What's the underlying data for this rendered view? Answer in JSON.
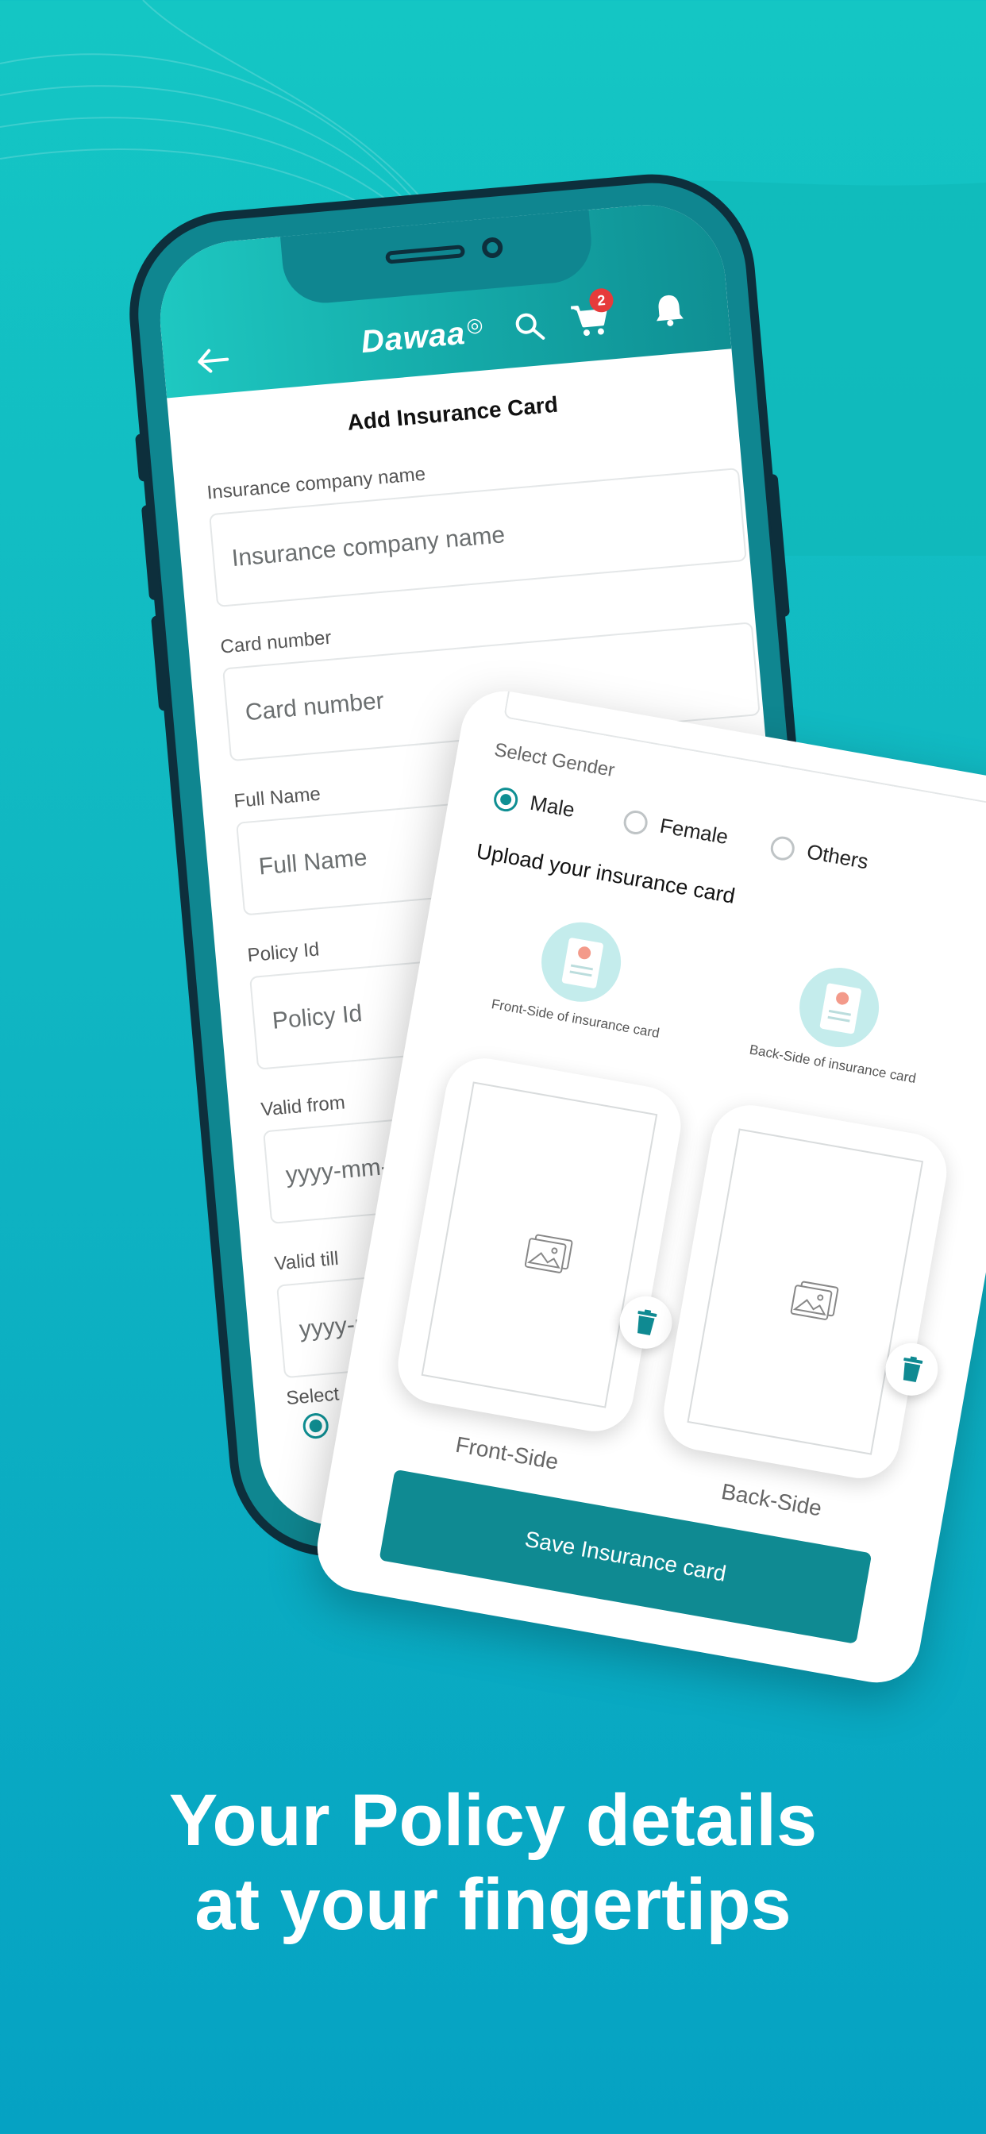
{
  "app": {
    "logo_text": "Dawaa",
    "cart_count": "2"
  },
  "form": {
    "title": "Add Insurance Card",
    "fields": [
      {
        "label": "Insurance company name",
        "placeholder": "Insurance company name"
      },
      {
        "label": "Card number",
        "placeholder": "Card number"
      },
      {
        "label": "Full Name",
        "placeholder": "Full Name"
      },
      {
        "label": "Policy Id",
        "placeholder": "Policy Id"
      },
      {
        "label": "Valid from",
        "placeholder": "yyyy-mm-dd"
      },
      {
        "label": "Valid till",
        "placeholder": "yyyy-mm-dd"
      }
    ],
    "gender_label": "Select Gender",
    "gender_options": [
      "Male",
      "Female",
      "Others"
    ],
    "gender_selected": "Male"
  },
  "upload": {
    "heading": "Upload your insurance card",
    "front_caption": "Front-Side of insurance card",
    "back_caption": "Back-Side of insurance card",
    "front_label": "Front-Side",
    "back_label": "Back-Side",
    "save_label": "Save Insurance card"
  },
  "marketing": {
    "headline_line1": "Your Policy details",
    "headline_line2": "at your fingertips"
  },
  "colors": {
    "accent": "#0f8a92",
    "badge": "#e63b3b",
    "background_top": "#14c6c4",
    "background_bottom": "#05a2c3"
  }
}
